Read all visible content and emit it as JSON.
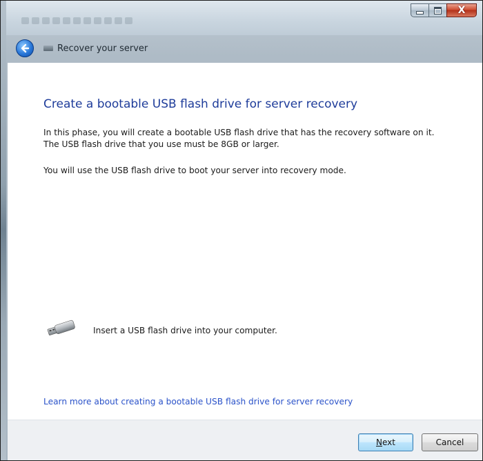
{
  "window": {
    "title": "Recover your server",
    "caption_buttons": {
      "minimize_icon": "minimize-icon",
      "maximize_icon": "maximize-icon",
      "close_glyph": "X"
    }
  },
  "wizard": {
    "heading": "Create a bootable USB flash drive for server recovery",
    "paragraph1": "In this phase, you will create a bootable USB flash drive that has the recovery software on it. The USB flash drive that you use must be 8GB or larger.",
    "paragraph2": "You will use the USB flash drive to boot your server into recovery mode.",
    "usb_instruction": "Insert a USB flash drive into your computer.",
    "learn_more_link": "Learn more about creating a bootable USB flash drive for server recovery"
  },
  "footer": {
    "next_label_accel": "N",
    "next_label_rest": "ext",
    "cancel_label": "Cancel"
  },
  "colors": {
    "heading": "#1e3c9a",
    "link": "#2a52c9",
    "close_button": "#c2391f"
  }
}
